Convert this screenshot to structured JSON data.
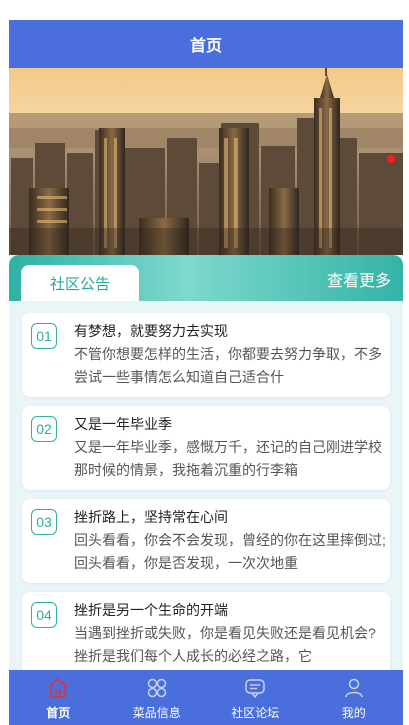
{
  "header": {
    "title": "首页"
  },
  "banner": {
    "active_indicator_color": "#ff1c1c"
  },
  "notice": {
    "tab_label": "社区公告",
    "more_label": "查看更多",
    "items": [
      {
        "num": "01",
        "title": "有梦想，就要努力去实现",
        "text": "不管你想要怎样的生活，你都要去努力争取，不多尝试一些事情怎么知道自己适合什"
      },
      {
        "num": "02",
        "title": "又是一年毕业季",
        "text": "又是一年毕业季，感慨万千，还记的自己刚进学校那时候的情景，我拖着沉重的行李箱"
      },
      {
        "num": "03",
        "title": "挫折路上，坚持常在心间",
        "text": "回头看看，你会不会发现，曾经的你在这里摔倒过;回头看看，你是否发现，一次次地重"
      },
      {
        "num": "04",
        "title": "挫折是另一个生命的开端",
        "text": "当遇到挫折或失败，你是看见失败还是看见机会?挫折是我们每个人成长的必经之路，它"
      }
    ]
  },
  "tabbar": {
    "items": [
      {
        "label": "首页",
        "icon": "home-icon",
        "active": true
      },
      {
        "label": "菜品信息",
        "icon": "grid-icon",
        "active": false
      },
      {
        "label": "社区论坛",
        "icon": "forum-icon",
        "active": false
      },
      {
        "label": "我的",
        "icon": "user-icon",
        "active": false
      }
    ]
  },
  "colors": {
    "primary": "#4a6fdc",
    "accent": "#2faf9f"
  }
}
